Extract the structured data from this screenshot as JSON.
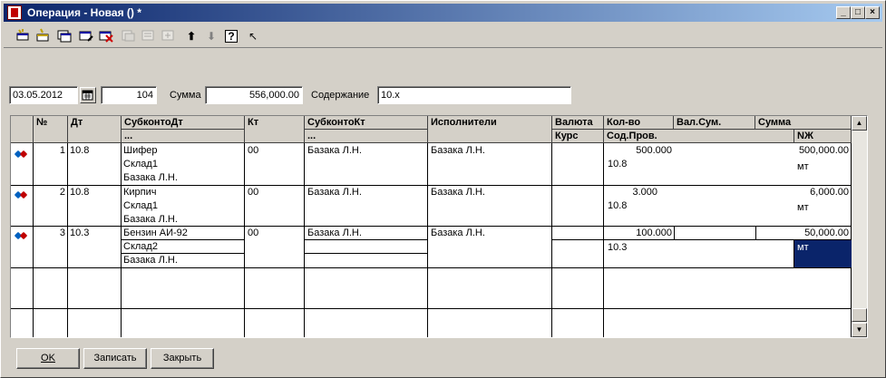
{
  "window": {
    "title": "Операция - Новая () *",
    "controls": {
      "minimize": "_",
      "restore": "□",
      "close": "×"
    }
  },
  "toolbar": {
    "icons": [
      "new-row-icon",
      "insert-row-icon",
      "copy-row-icon",
      "edit-row-icon",
      "delete-row-icon",
      "disabled-icon-1",
      "disabled-icon-2",
      "disabled-icon-3",
      "move-up-icon",
      "move-down-icon",
      "help-icon",
      "context-help-icon"
    ],
    "glyphs": {
      "up": "⬆",
      "down": "⬇",
      "help": "?",
      "cursor": "↖"
    }
  },
  "form": {
    "date": "03.05.2012",
    "number": "104",
    "sum_label": "Сумма",
    "sum_value": "556,000.00",
    "content_label": "Содержание",
    "content_value": "10.х"
  },
  "grid": {
    "headers": {
      "num": "№",
      "dt": "Дт",
      "subkonto_dt": "СубконтоДт",
      "subkonto_dt_sub": "...",
      "kt": "Кт",
      "subkonto_kt": "СубконтоКт",
      "subkonto_kt_sub": "...",
      "performers": "Исполнители",
      "currency": "Валюта",
      "rate": "Курс",
      "qty": "Кол-во",
      "val_sum": "Вал.Сум.",
      "sum": "Сумма",
      "content_prov": "Сод.Пров.",
      "nzh": "NЖ"
    },
    "rows": [
      {
        "num": "1",
        "dt": "10.8",
        "sub_dt": [
          "Шифер",
          "Склад1",
          "Базака Л.Н."
        ],
        "kt": "00",
        "sub_kt": [
          "Базака Л.Н."
        ],
        "performer": "Базака Л.Н.",
        "qty": "500.000",
        "sum": "500,000.00",
        "content": "10.8",
        "nzh": "мт"
      },
      {
        "num": "2",
        "dt": "10.8",
        "sub_dt": [
          "Кирпич",
          "Склад1",
          "Базака Л.Н."
        ],
        "kt": "00",
        "sub_kt": [
          "Базака Л.Н."
        ],
        "performer": "Базака Л.Н.",
        "qty": "3.000",
        "sum": "6,000.00",
        "content": "10.8",
        "nzh": "мт"
      },
      {
        "num": "3",
        "dt": "10.3",
        "sub_dt": [
          "Бензин АИ-92",
          "Склад2",
          "Базака Л.Н."
        ],
        "kt": "00",
        "sub_kt": [
          "Базака Л.Н."
        ],
        "performer": "Базака Л.Н.",
        "qty": "100.000",
        "sum": "50,000.00",
        "content": "10.3",
        "nzh": "мт"
      }
    ]
  },
  "buttons": {
    "ok": "OK",
    "save": "Записать",
    "close": "Закрыть"
  },
  "colors": {
    "selection": "#0a246a",
    "title_start": "#0a246a",
    "title_end": "#a6caf0"
  }
}
